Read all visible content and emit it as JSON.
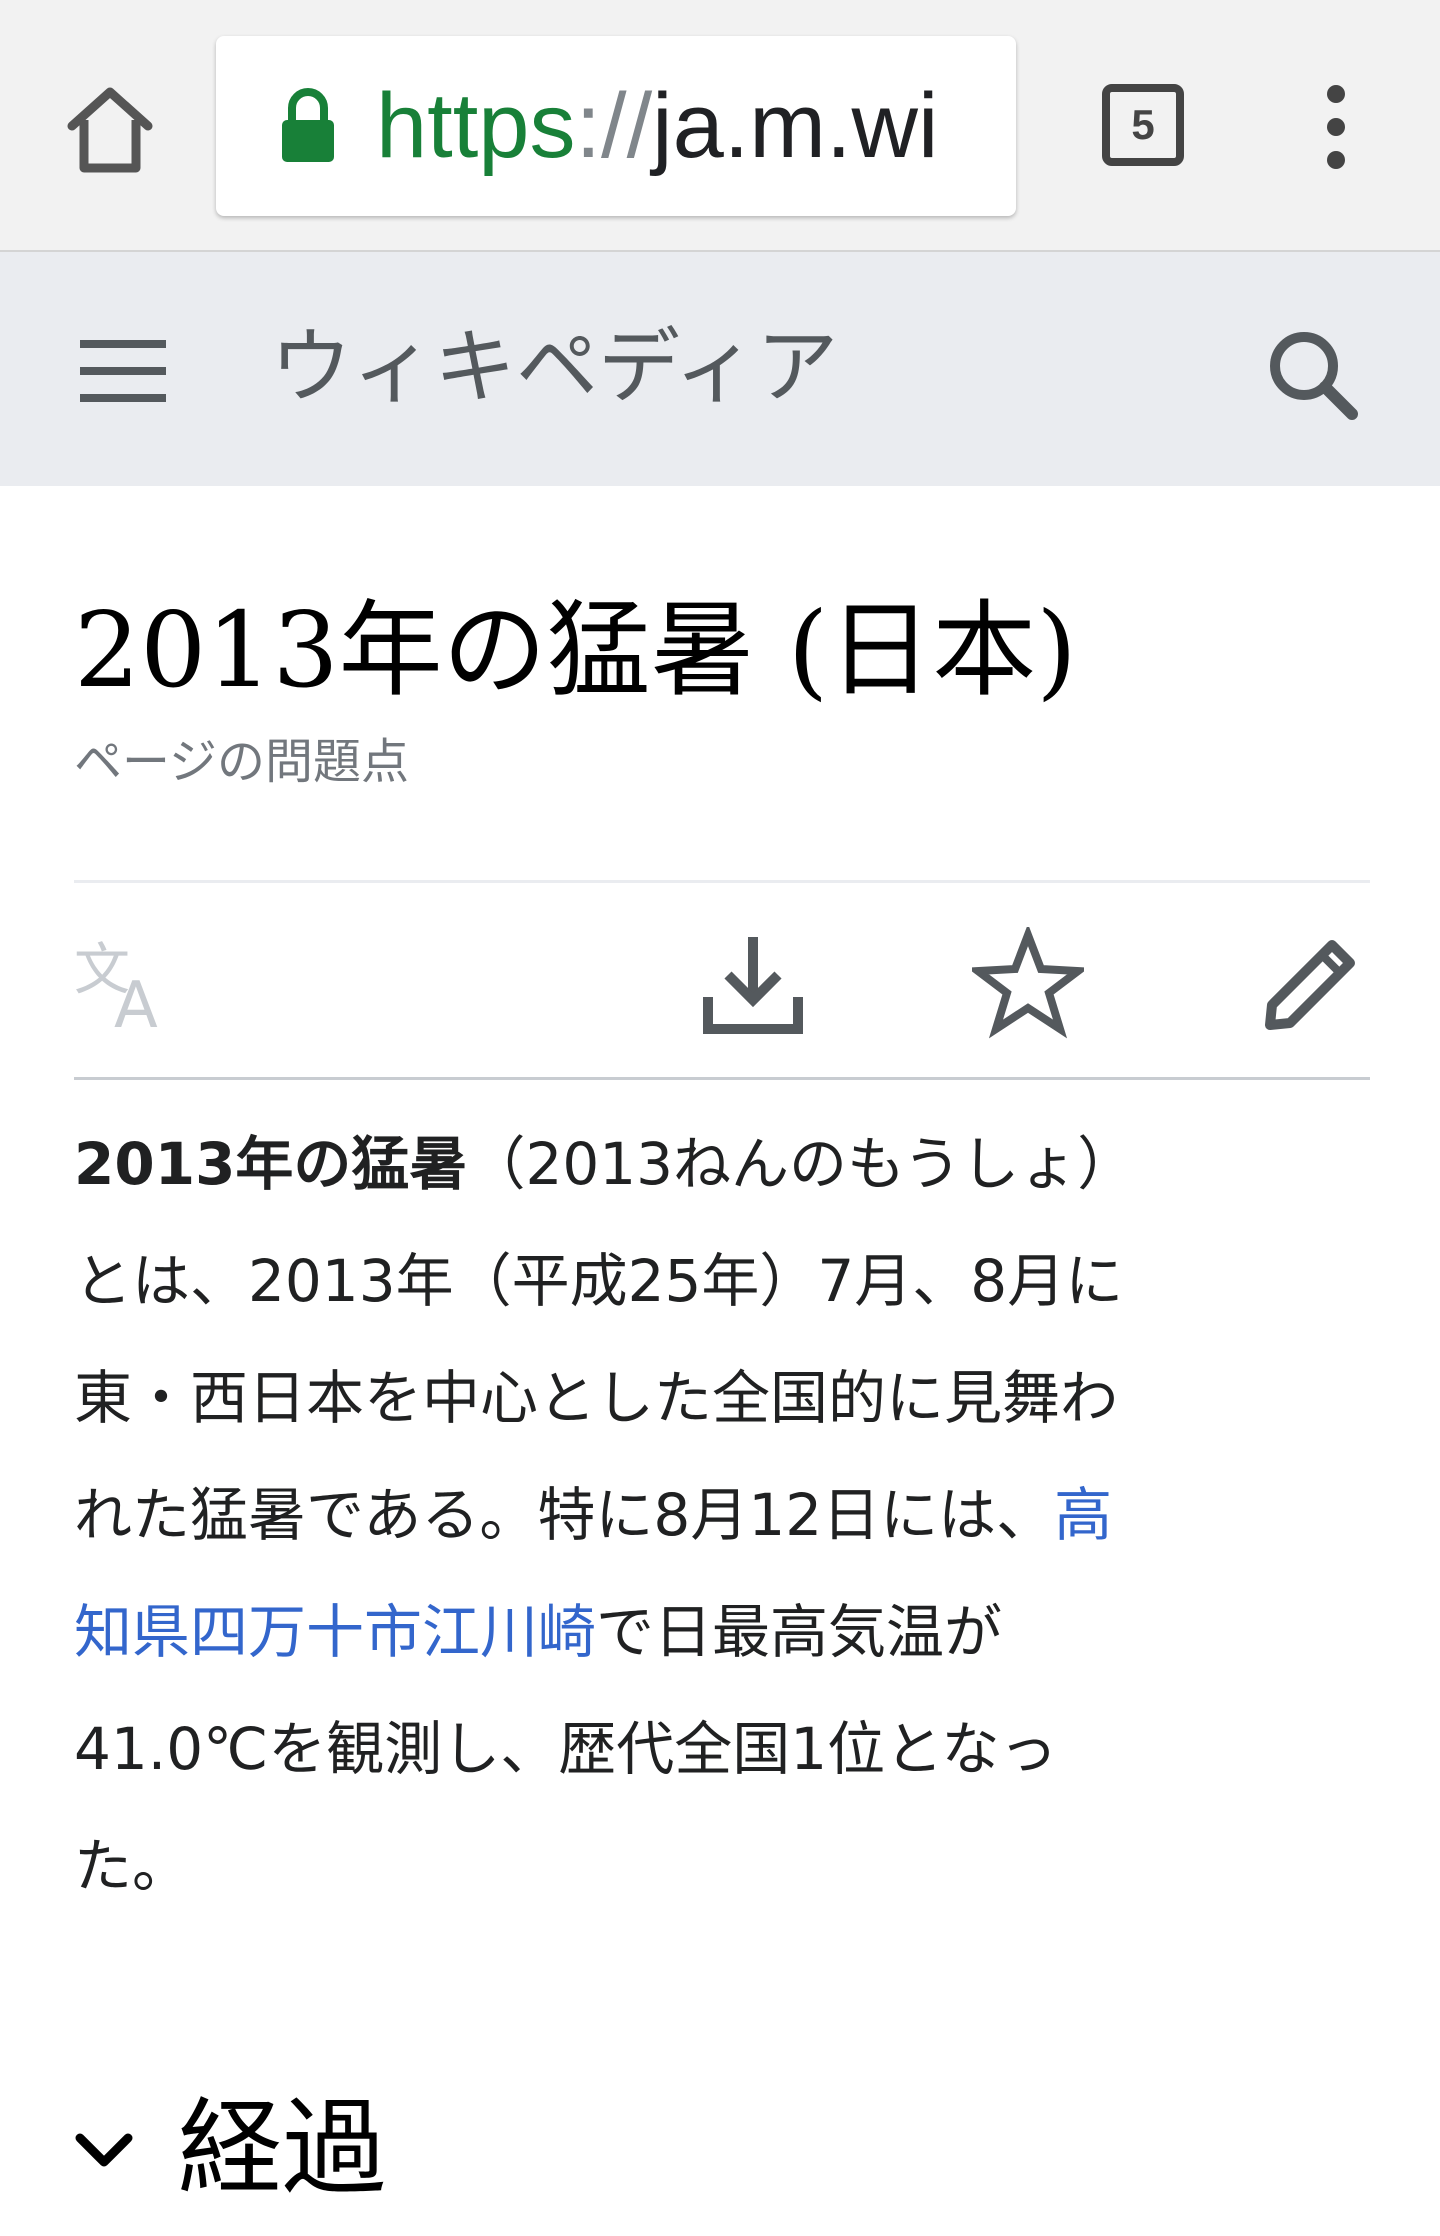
{
  "browser": {
    "url_scheme": "https",
    "url_sep": "://",
    "url_rest": "ja.m.wi",
    "tab_count": "5"
  },
  "header": {
    "site_title": "ウィキペディア"
  },
  "article": {
    "title": "2013年の猛暑 (日本)",
    "issues_link": "ページの問題点",
    "intro": {
      "bold_term": "2013年の猛暑",
      "line1_rest": "（2013ねんのもうしょ）",
      "line2": "とは、2013年（平成25年）7月、8月に",
      "line3": "東・西日本を中心とした全国的に見舞わ",
      "line4_text": "れた猛暑である。特に8月12日には、",
      "line4_link": "高",
      "line5_link": "知県四万十市江川崎",
      "line5_rest": "で日最高気温が",
      "line6": "41.0℃を観測し、歴代全国1位となっ",
      "line7": "た。"
    },
    "section": {
      "title": "経過"
    }
  },
  "colors": {
    "link": "#3366cc",
    "url_secure": "#188038",
    "header_bg": "#eaecf0"
  },
  "icons": [
    "home-icon",
    "lock-icon",
    "tabs-icon",
    "more-vert-icon",
    "menu-icon",
    "search-icon",
    "language-icon",
    "download-icon",
    "star-icon",
    "edit-icon",
    "chevron-down-icon"
  ]
}
